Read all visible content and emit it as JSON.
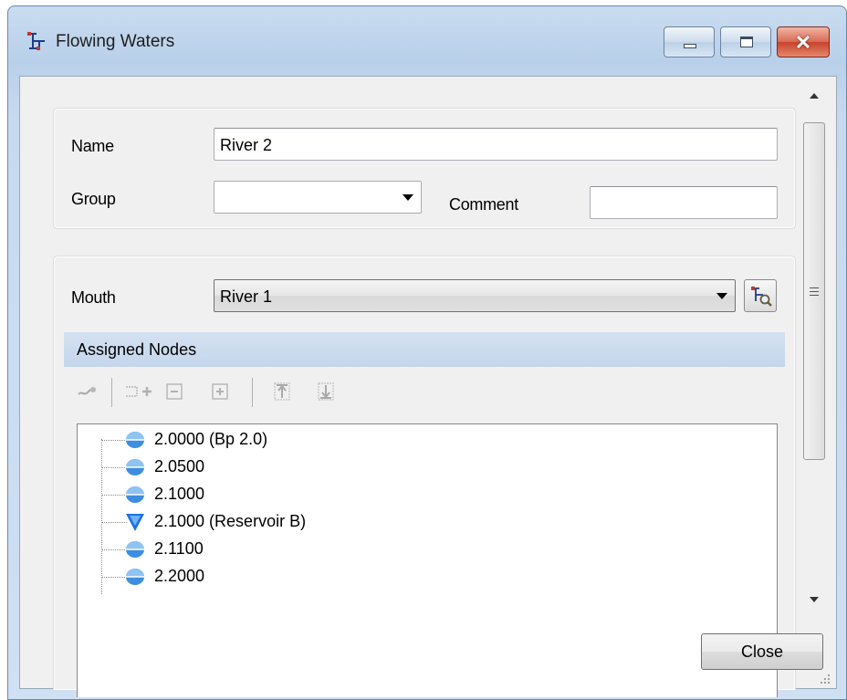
{
  "window": {
    "title": "Flowing Waters",
    "icon": "network-icon"
  },
  "form": {
    "name_label": "Name",
    "name_value": "River 2",
    "group_label": "Group",
    "group_value": "",
    "comment_label": "Comment",
    "comment_value": "",
    "mouth_label": "Mouth",
    "mouth_value": "River 1"
  },
  "assigned_nodes": {
    "header": "Assigned Nodes",
    "toolbar_icons": [
      "connect-icon",
      "add-node-icon",
      "collapse-icon",
      "expand-icon",
      "move-up-icon",
      "move-down-icon"
    ],
    "nodes": [
      {
        "label": "2.0000 (Bp 2.0)",
        "icon": "node-circle-icon"
      },
      {
        "label": "2.0500",
        "icon": "node-circle-icon"
      },
      {
        "label": "2.1000",
        "icon": "node-circle-icon"
      },
      {
        "label": "2.1000 (Reservoir B)",
        "icon": "reservoir-triangle-icon"
      },
      {
        "label": "2.1100",
        "icon": "node-circle-icon"
      },
      {
        "label": "2.2000",
        "icon": "node-circle-icon"
      }
    ]
  },
  "buttons": {
    "close_label": "Close"
  },
  "colors": {
    "selection_bar": "#c8d9ee",
    "node_blue": "#3d8ee0",
    "reservoir_blue": "#1f6fe0"
  }
}
